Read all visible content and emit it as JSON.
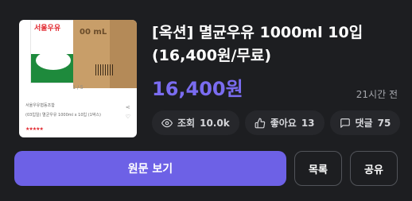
{
  "post": {
    "title": "[옥션] 멸균우유 1000ml 10입 (16,400원/무료)",
    "price": "16,400원",
    "time_ago": "21시간 전"
  },
  "thumbnail": {
    "brand_text": "서울우유",
    "box_text": "00 mL",
    "page_indicator": "1 / 5",
    "seller_line": "서울우유협동조합",
    "product_line": "(03입일) 멸균우유 1000ml x 10입 (1박스)"
  },
  "stats": {
    "views_label": "조회",
    "views_value": "10.0k",
    "likes_label": "좋아요",
    "likes_value": "13",
    "comments_label": "댓글",
    "comments_value": "75"
  },
  "actions": {
    "view_original": "원문 보기",
    "list": "목록",
    "share": "공유"
  },
  "icons": [
    "eye-icon",
    "thumbs-up-icon",
    "comment-icon"
  ],
  "colors": {
    "background": "#1d1e21",
    "accent": "#6d61e6",
    "price": "#7a6cf0",
    "chip": "#26272b"
  }
}
